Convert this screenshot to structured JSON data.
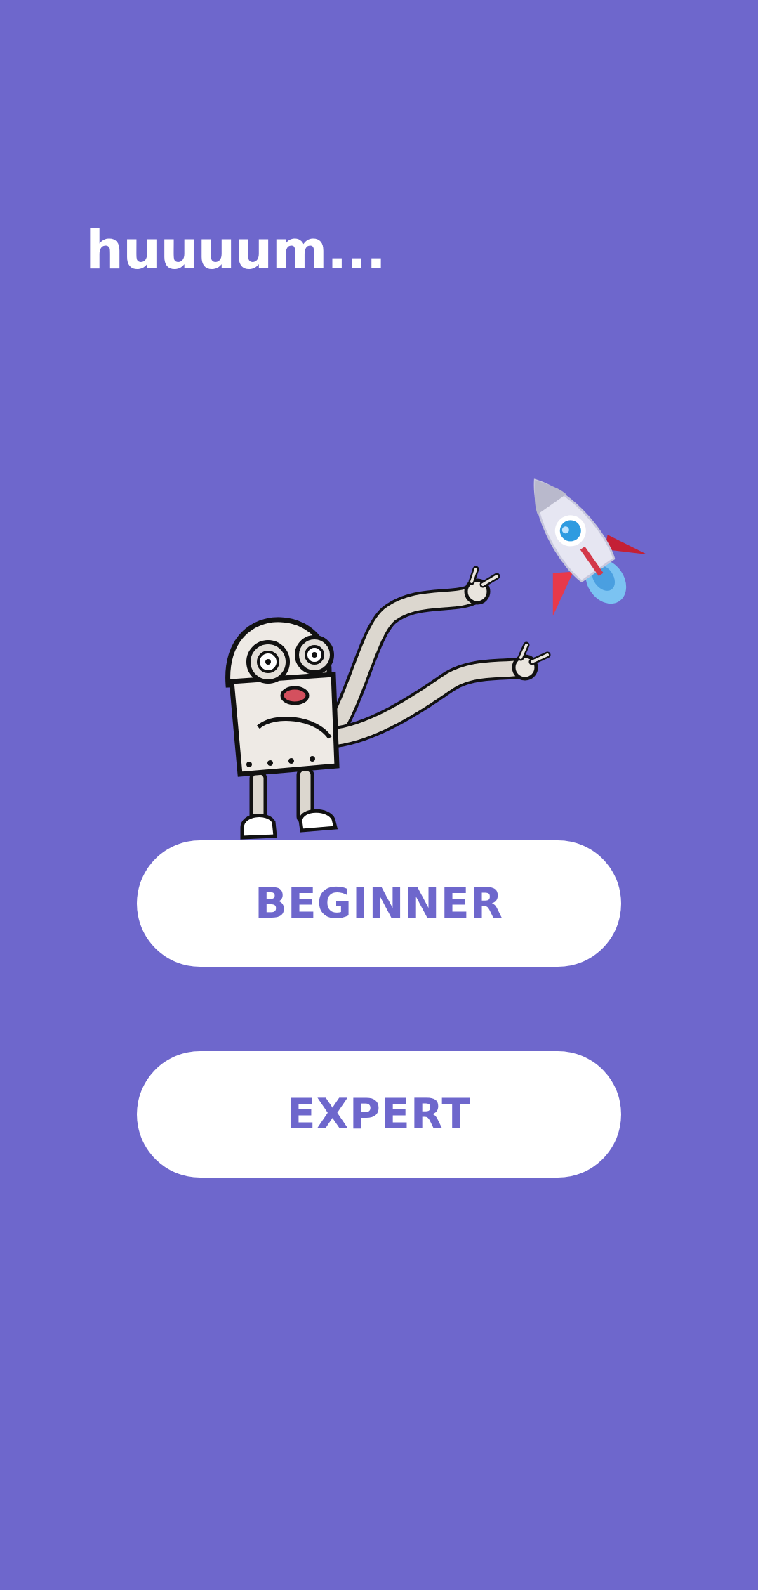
{
  "screen": {
    "background": "#6e67cc",
    "headline": "huuuum...",
    "illustration": {
      "robot_icon": "robot-icon",
      "rocket_icon": "rocket-icon"
    },
    "buttons": [
      {
        "label": "BEGINNER",
        "color": "#6e67cc"
      },
      {
        "label": "EXPERT",
        "color": "#6e67cc"
      }
    ]
  }
}
